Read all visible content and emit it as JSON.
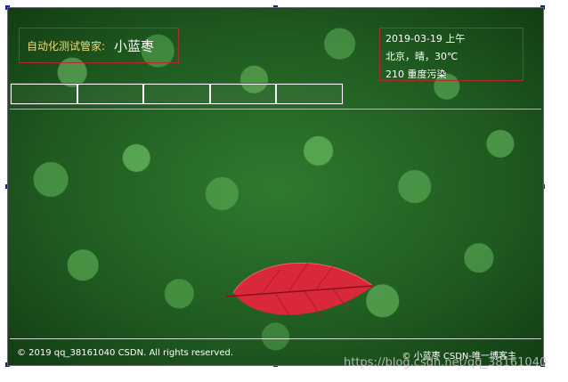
{
  "header": {
    "title_label": "自动化测试管家:",
    "title_name": "小蓝枣"
  },
  "info": {
    "datetime": "2019-03-19 上午",
    "weather": "北京，晴，30℃",
    "air": "210 重度污染"
  },
  "nav": {
    "buttons": [
      "",
      "",
      "",
      "",
      ""
    ]
  },
  "footer": {
    "copyright": "© 2019 qq_38161040 CSDN. All rights reserved.",
    "credit": "© 小蓝枣 CSDN-唯一博客主"
  },
  "watermark": "https://blog.csdn.net/qq_38161040",
  "colors": {
    "frame_border": "#b22a2a",
    "selection_handle": "#1b1bb0",
    "leaf": "#d8283a"
  },
  "icons": {
    "leaf": "red-leaf-illustration"
  }
}
